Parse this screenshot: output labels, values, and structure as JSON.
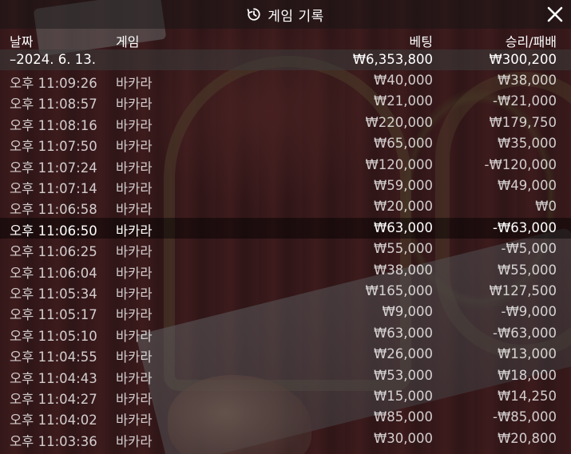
{
  "header": {
    "title": "게임 기록",
    "icon": "history-icon",
    "close_icon": "close-icon"
  },
  "columns": {
    "date": "날짜",
    "game": "게임",
    "bet": "베팅",
    "winloss": "승리/패배"
  },
  "summary": {
    "date": "–2024. 6. 13.",
    "bet": "₩6,353,800",
    "winloss": "₩300,200"
  },
  "rows": [
    {
      "time": "오후 11:09:26",
      "game": "바카라",
      "bet": "₩40,000",
      "winloss": "₩38,000"
    },
    {
      "time": "오후 11:08:57",
      "game": "바카라",
      "bet": "₩21,000",
      "winloss": "-₩21,000"
    },
    {
      "time": "오후 11:08:16",
      "game": "바카라",
      "bet": "₩220,000",
      "winloss": "₩179,750"
    },
    {
      "time": "오후 11:07:50",
      "game": "바카라",
      "bet": "₩65,000",
      "winloss": "₩35,000"
    },
    {
      "time": "오후 11:07:24",
      "game": "바카라",
      "bet": "₩120,000",
      "winloss": "-₩120,000"
    },
    {
      "time": "오후 11:07:14",
      "game": "바카라",
      "bet": "₩59,000",
      "winloss": "₩49,000"
    },
    {
      "time": "오후 11:06:58",
      "game": "바카라",
      "bet": "₩20,000",
      "winloss": "₩0"
    },
    {
      "time": "오후 11:06:50",
      "game": "바카라",
      "bet": "₩63,000",
      "winloss": "-₩63,000"
    },
    {
      "time": "오후 11:06:25",
      "game": "바카라",
      "bet": "₩55,000",
      "winloss": "-₩5,000"
    },
    {
      "time": "오후 11:06:04",
      "game": "바카라",
      "bet": "₩38,000",
      "winloss": "₩55,000"
    },
    {
      "time": "오후 11:05:34",
      "game": "바카라",
      "bet": "₩165,000",
      "winloss": "₩127,500"
    },
    {
      "time": "오후 11:05:17",
      "game": "바카라",
      "bet": "₩9,000",
      "winloss": "-₩9,000"
    },
    {
      "time": "오후 11:05:10",
      "game": "바카라",
      "bet": "₩63,000",
      "winloss": "-₩63,000"
    },
    {
      "time": "오후 11:04:55",
      "game": "바카라",
      "bet": "₩26,000",
      "winloss": "₩13,000"
    },
    {
      "time": "오후 11:04:43",
      "game": "바카라",
      "bet": "₩53,000",
      "winloss": "₩18,000"
    },
    {
      "time": "오후 11:04:27",
      "game": "바카라",
      "bet": "₩15,000",
      "winloss": "₩14,250"
    },
    {
      "time": "오후 11:04:02",
      "game": "바카라",
      "bet": "₩85,000",
      "winloss": "-₩85,000"
    },
    {
      "time": "오후 11:03:36",
      "game": "바카라",
      "bet": "₩30,000",
      "winloss": "₩20,800"
    }
  ],
  "highlighted_row_index": 7
}
